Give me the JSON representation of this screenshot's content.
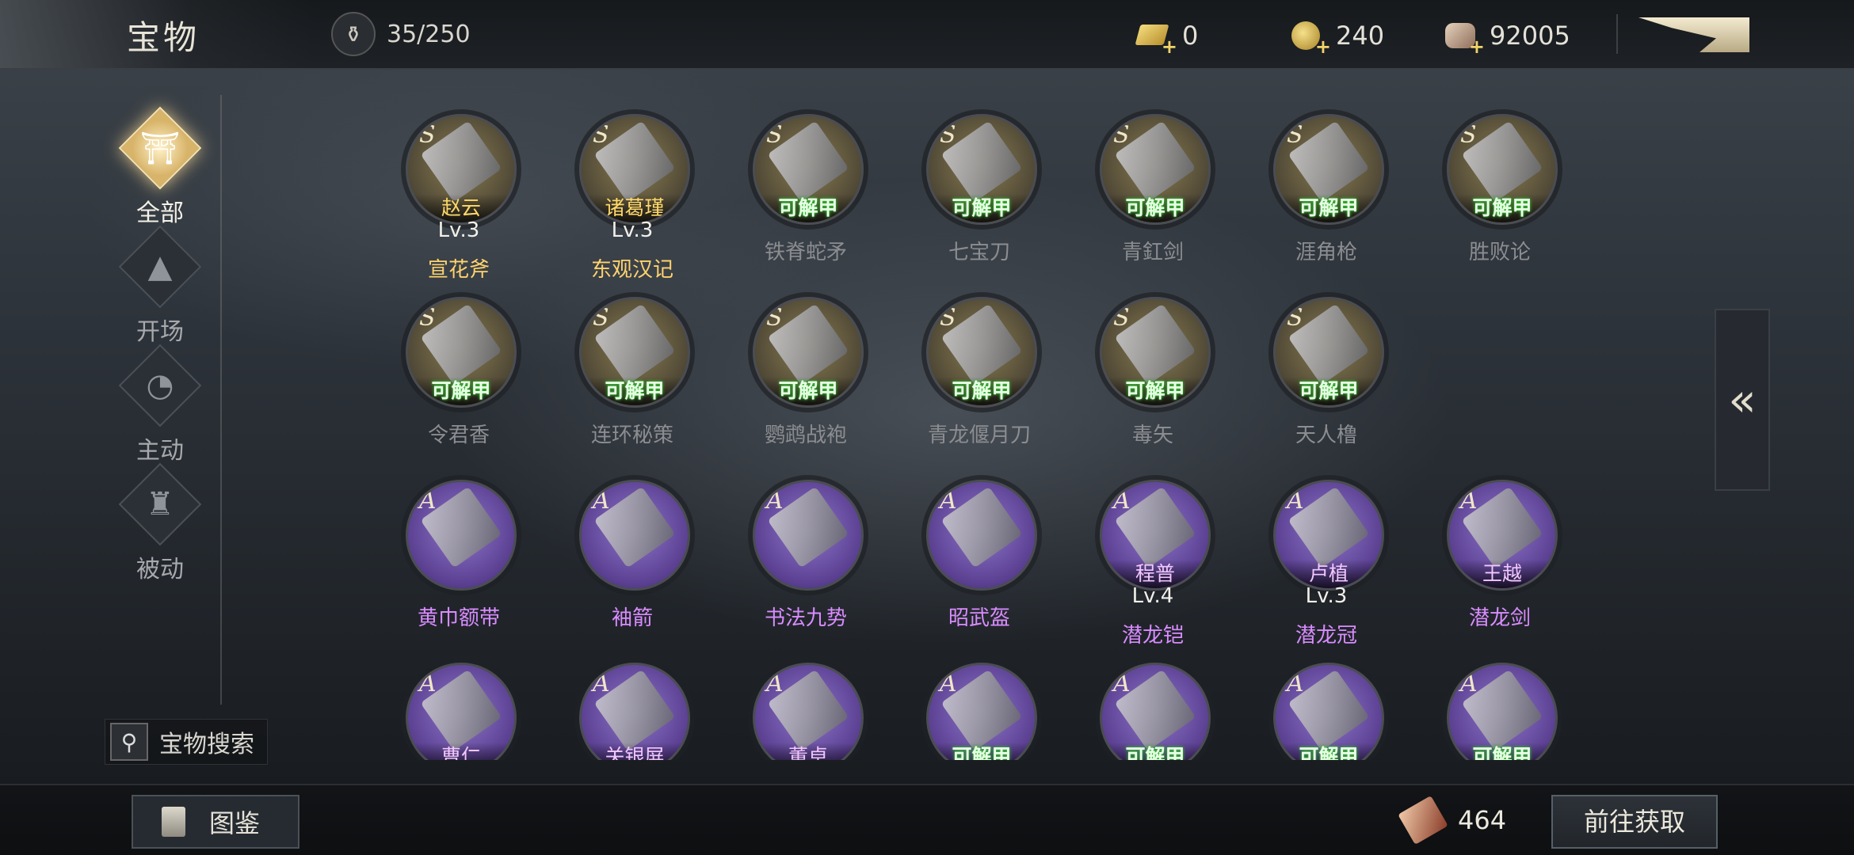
{
  "header": {
    "title": "宝物",
    "capacity": "35/250",
    "currencies": [
      {
        "name": "gold-bar",
        "value": "0"
      },
      {
        "name": "coin",
        "value": "240"
      },
      {
        "name": "scroll",
        "value": "92005"
      }
    ]
  },
  "sidebar": {
    "categories": [
      {
        "label": "全部",
        "icon": "all-treasure-icon",
        "active": true
      },
      {
        "label": "开场",
        "icon": "opening-icon",
        "active": false
      },
      {
        "label": "主动",
        "icon": "active-skill-icon",
        "active": false
      },
      {
        "label": "被动",
        "icon": "passive-skill-icon",
        "active": false
      }
    ],
    "search_label": "宝物搜索"
  },
  "items": [
    {
      "rank": "S",
      "tag": "赵云",
      "tag_type": "hero",
      "level": "Lv.3",
      "name": "宣花斧",
      "owned": true
    },
    {
      "rank": "S",
      "tag": "诸葛瑾",
      "tag_type": "hero",
      "level": "Lv.3",
      "name": "东观汉记",
      "owned": true
    },
    {
      "rank": "S",
      "tag": "可解甲",
      "tag_type": "unlock",
      "level": "",
      "name": "铁脊蛇矛",
      "owned": false
    },
    {
      "rank": "S",
      "tag": "可解甲",
      "tag_type": "unlock",
      "level": "",
      "name": "七宝刀",
      "owned": false
    },
    {
      "rank": "S",
      "tag": "可解甲",
      "tag_type": "unlock",
      "level": "",
      "name": "青釭剑",
      "owned": false
    },
    {
      "rank": "S",
      "tag": "可解甲",
      "tag_type": "unlock",
      "level": "",
      "name": "涯角枪",
      "owned": false
    },
    {
      "rank": "S",
      "tag": "可解甲",
      "tag_type": "unlock",
      "level": "",
      "name": "胜败论",
      "owned": false
    },
    {
      "rank": "S",
      "tag": "可解甲",
      "tag_type": "unlock",
      "level": "",
      "name": "令君香",
      "owned": false
    },
    {
      "rank": "S",
      "tag": "可解甲",
      "tag_type": "unlock",
      "level": "",
      "name": "连环秘策",
      "owned": false
    },
    {
      "rank": "S",
      "tag": "可解甲",
      "tag_type": "unlock",
      "level": "",
      "name": "鹦鹉战袍",
      "owned": false
    },
    {
      "rank": "S",
      "tag": "可解甲",
      "tag_type": "unlock",
      "level": "",
      "name": "青龙偃月刀",
      "owned": false
    },
    {
      "rank": "S",
      "tag": "可解甲",
      "tag_type": "unlock",
      "level": "",
      "name": "毒矢",
      "owned": false
    },
    {
      "rank": "S",
      "tag": "可解甲",
      "tag_type": "unlock",
      "level": "",
      "name": "天人橹",
      "owned": false
    },
    {
      "rank": "A",
      "tag": "",
      "tag_type": "none",
      "level": "",
      "name": "黄巾额带",
      "owned": false
    },
    {
      "rank": "A",
      "tag": "",
      "tag_type": "none",
      "level": "",
      "name": "袖箭",
      "owned": false
    },
    {
      "rank": "A",
      "tag": "",
      "tag_type": "none",
      "level": "",
      "name": "书法九势",
      "owned": false
    },
    {
      "rank": "A",
      "tag": "",
      "tag_type": "none",
      "level": "",
      "name": "昭武盔",
      "owned": false
    },
    {
      "rank": "A",
      "tag": "程普",
      "tag_type": "hero",
      "level": "Lv.4",
      "name": "潜龙铠",
      "owned": false
    },
    {
      "rank": "A",
      "tag": "卢植",
      "tag_type": "hero",
      "level": "Lv.3",
      "name": "潜龙冠",
      "owned": false
    },
    {
      "rank": "A",
      "tag": "王越",
      "tag_type": "hero",
      "level": "",
      "name": "潜龙剑",
      "owned": false
    },
    {
      "rank": "A",
      "tag": "曹仁",
      "tag_type": "hero",
      "level": "",
      "name": "",
      "owned": false
    },
    {
      "rank": "A",
      "tag": "关银屏",
      "tag_type": "hero",
      "level": "",
      "name": "",
      "owned": false
    },
    {
      "rank": "A",
      "tag": "董卓",
      "tag_type": "hero",
      "level": "",
      "name": "",
      "owned": false
    },
    {
      "rank": "A",
      "tag": "可解甲",
      "tag_type": "unlock",
      "level": "",
      "name": "",
      "owned": false
    },
    {
      "rank": "A",
      "tag": "可解甲",
      "tag_type": "unlock",
      "level": "",
      "name": "",
      "owned": false
    },
    {
      "rank": "A",
      "tag": "可解甲",
      "tag_type": "unlock",
      "level": "",
      "name": "",
      "owned": false
    },
    {
      "rank": "A",
      "tag": "可解甲",
      "tag_type": "unlock",
      "level": "",
      "name": "",
      "owned": false
    }
  ],
  "collapse_label": "«",
  "footer": {
    "handbook_label": "图鉴",
    "shard_count": "464",
    "goto_label": "前往获取"
  }
}
